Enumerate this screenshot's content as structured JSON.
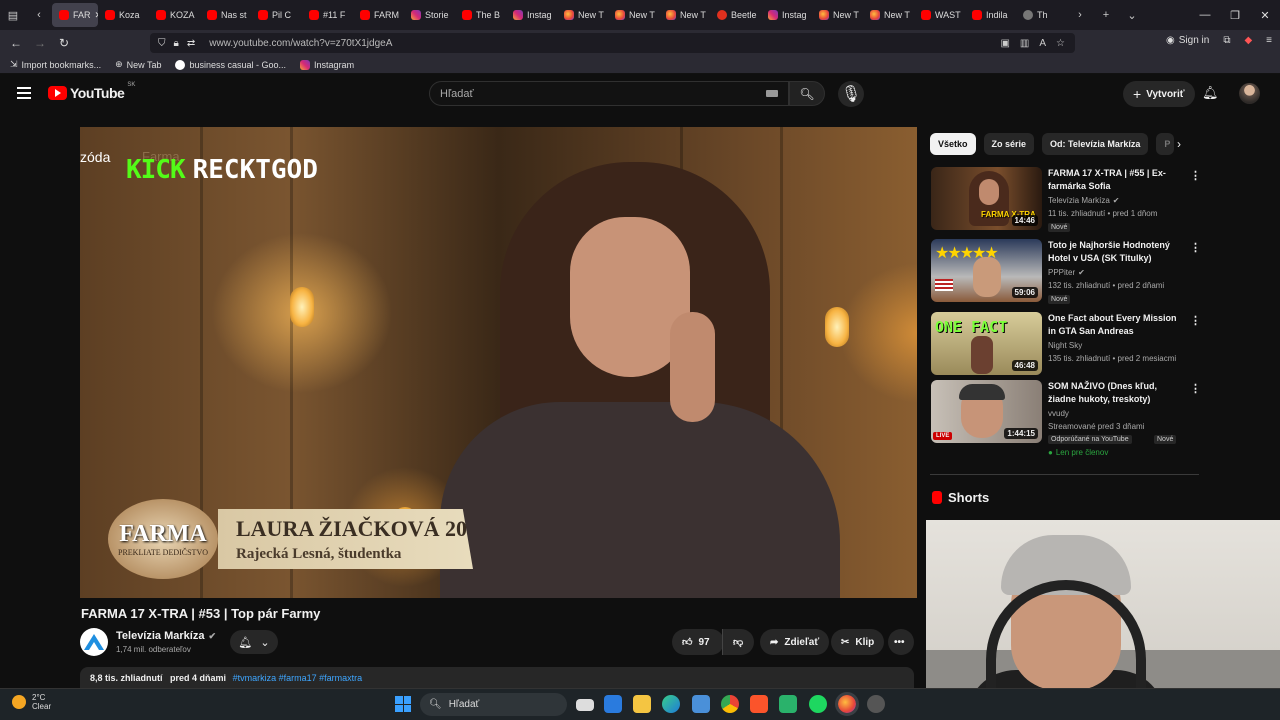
{
  "browser": {
    "tabs": [
      {
        "label": "FAR",
        "icon": "youtube",
        "active": true
      },
      {
        "label": "Koza",
        "icon": "youtube"
      },
      {
        "label": "KOZA",
        "icon": "youtube"
      },
      {
        "label": "Nas st",
        "icon": "youtube"
      },
      {
        "label": "Pil C",
        "icon": "youtube"
      },
      {
        "label": "#11 F",
        "icon": "youtube"
      },
      {
        "label": "FARM",
        "icon": "youtube"
      },
      {
        "label": "Storie",
        "icon": "instagram"
      },
      {
        "label": "The B",
        "icon": "youtube"
      },
      {
        "label": "Instag",
        "icon": "instagram"
      },
      {
        "label": "New T",
        "icon": "firefox"
      },
      {
        "label": "New T",
        "icon": "firefox"
      },
      {
        "label": "New T",
        "icon": "firefox"
      },
      {
        "label": "Beetle",
        "icon": "beetle"
      },
      {
        "label": "Instag",
        "icon": "instagram"
      },
      {
        "label": "New T",
        "icon": "firefox"
      },
      {
        "label": "New T",
        "icon": "firefox"
      },
      {
        "label": "WAST",
        "icon": "youtube"
      },
      {
        "label": "Indila",
        "icon": "youtube"
      },
      {
        "label": "Th",
        "icon": "generic"
      }
    ],
    "url": "www.youtube.com/watch?v=z70tX1jdgeA",
    "sign_in": "Sign in",
    "bookmarks": [
      "Import bookmarks...",
      "New Tab",
      "business casual - Goo...",
      "Instagram"
    ]
  },
  "youtube": {
    "logo_text": "YouTube",
    "region": "SK",
    "search_placeholder": "Hľadať",
    "create_label": "Vytvoriť"
  },
  "video": {
    "overlay_episode": "zóda",
    "overlay_farma": "Farma",
    "kick_brand": "KICK",
    "kick_user": "RECKTGOD",
    "lower_third_logo": "FARMA",
    "lower_third_logo_sub": "PREKLIATE DEDIČSTVO",
    "lower_third_name": "LAURA ŽIAČKOVÁ 20",
    "lower_third_sub": "Rajecká Lesná, študentka",
    "title": "FARMA 17 X-TRA | #53 | Top pár Farmy",
    "channel": "Televízia Markíza",
    "subscribers": "1,74 mil. odberateľov",
    "likes": "97",
    "share_label": "Zdieľať",
    "clip_label": "Klip",
    "views": "8,8 tis. zhliadnutí",
    "date": "pred 4 dňami",
    "hashtags": "#tvmarkiza #farma17 #farmaxtra"
  },
  "sidebar": {
    "chips": [
      "Všetko",
      "Zo série",
      "Od: Televízia Markíza",
      "P"
    ],
    "recommendations": [
      {
        "title": "FARMA 17 X-TRA | #55 | Ex-farmárka Sofia",
        "channel": "Televízia Markíza",
        "meta": "11 tis. zhliadnutí • pred 1 dňom",
        "badge": "Nové",
        "duration": "14:46",
        "verified": true
      },
      {
        "title": "Toto je Najhoršie Hodnotený Hotel v USA (SK Titulky)",
        "channel": "PPPiter",
        "meta": "132 tis. zhliadnutí • pred 2 dňami",
        "badge": "Nové",
        "duration": "59:06",
        "verified": true
      },
      {
        "title": "One Fact about Every Mission in GTA San Andreas",
        "channel": "Night Sky",
        "meta": "135 tis. zhliadnutí • pred 2 mesiacmi",
        "badge": "",
        "duration": "46:48",
        "verified": false
      },
      {
        "title": "SOM NAŽIVO (Dnes kľud, žiadne hukoty, treskoty)",
        "channel": "vvudy",
        "meta": "Streamované pred 3 dňami",
        "badge": "Odporúčané na YouTube",
        "badge2": "Nové",
        "members": "Len pre členov",
        "duration": "1:44:15",
        "live": "LIVE",
        "verified": false
      }
    ],
    "shorts_label": "Shorts"
  },
  "thumb_texts": {
    "t1": "FARMA X-TRA",
    "t3": "ONE FACT"
  },
  "taskbar": {
    "temp": "2°C",
    "weather": "Clear",
    "search_placeholder": "Hľadať"
  }
}
